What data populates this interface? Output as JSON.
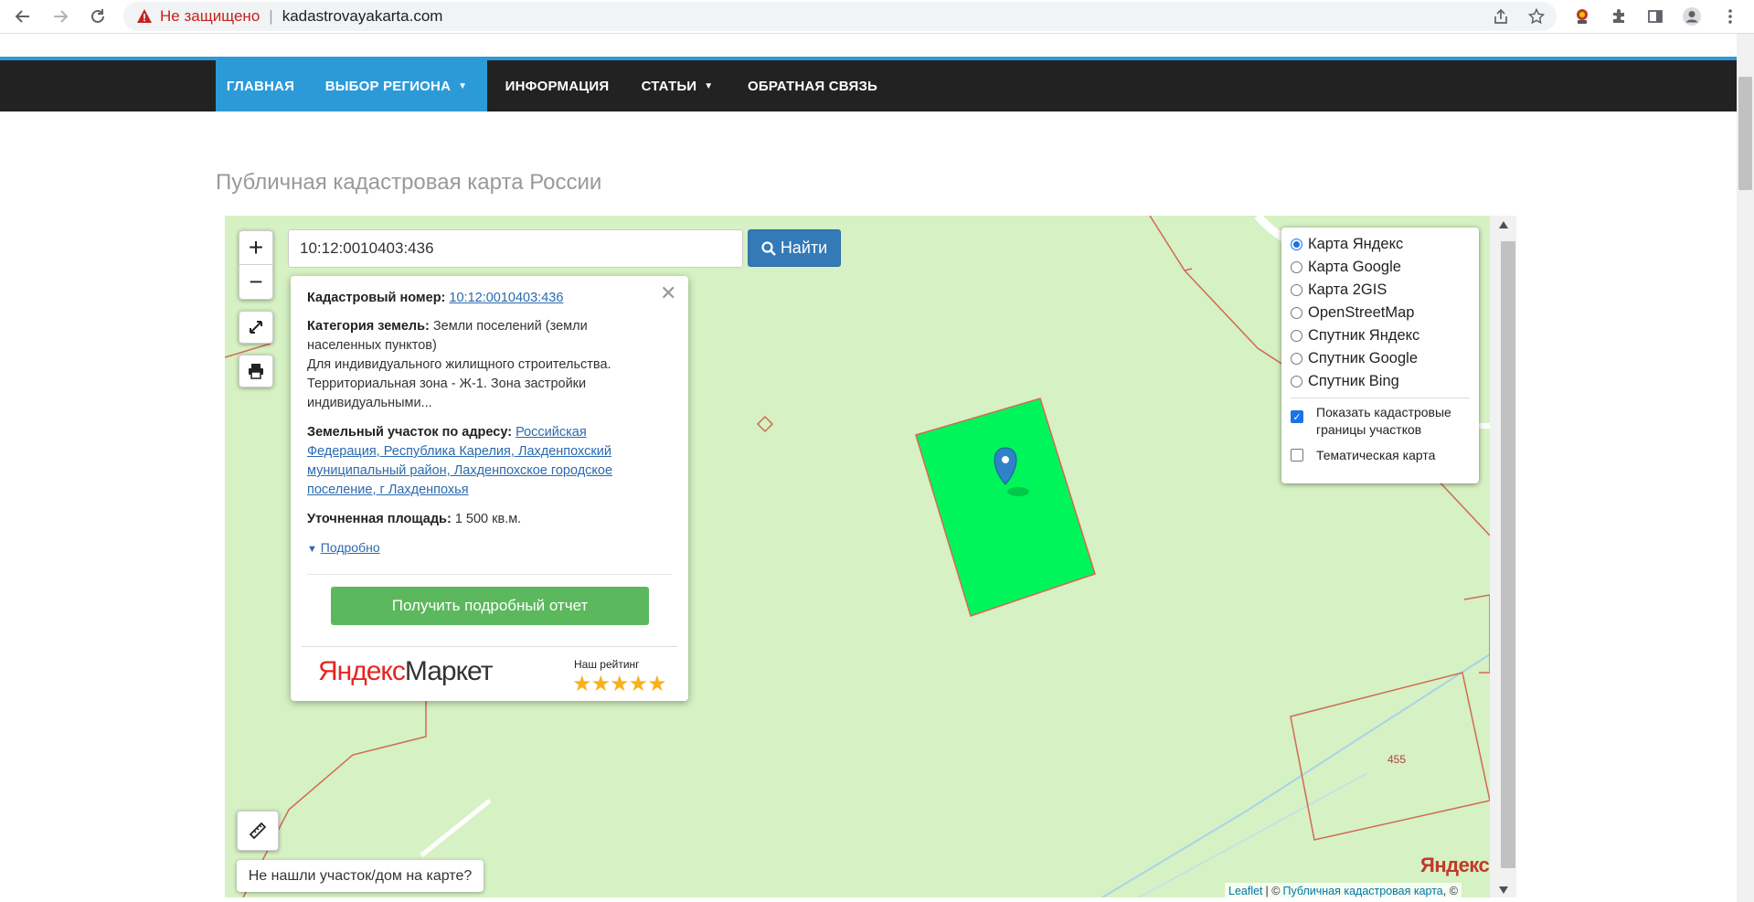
{
  "browser": {
    "security_label": "Не защищено",
    "separator": "|",
    "url": "kadastrovayakarta.com"
  },
  "nav": {
    "items": [
      {
        "label": "ГЛАВНАЯ"
      },
      {
        "label": "ВЫБОР РЕГИОНА"
      },
      {
        "label": "ИНФОРМАЦИЯ"
      },
      {
        "label": "СТАТЬИ"
      },
      {
        "label": "ОБРАТНАЯ СВЯЗЬ"
      }
    ]
  },
  "page_title": "Публичная кадастровая карта России",
  "map": {
    "zoom_in": "+",
    "zoom_out": "−",
    "search_value": "10:12:0010403:436",
    "search_button": "Найти",
    "hint": "Не нашли участок/дом на карте?",
    "parcel_label": "455",
    "yandex_logo": "Яндекс",
    "attribution": {
      "leaflet": "Leaflet",
      "divider": "| ©",
      "cadastral": "Публичная кадастровая карта",
      "tail": ", ©"
    }
  },
  "popup": {
    "cadastral_label": "Кадастровый номер:",
    "cadastral_value": "10:12:0010403:436",
    "category_label": "Категория земель:",
    "category_value": "Земли поселений (земли населенных пунктов)",
    "usage_text": "Для индивидуального жилищного строительства. Территориальная зона - Ж-1. Зона застройки индивидуальными...",
    "address_label": "Земельный участок по адресу:",
    "address_value": "Российская Федерация, Республика Карелия, Лахденпохский муниципальный район, Лахденпохское городское поселение, г Лахденпохья",
    "area_label": "Уточненная площадь:",
    "area_value": "1 500 кв.м.",
    "details_link": "Подробно",
    "report_button": "Получить подробный отчет",
    "market_logo_ya": "Яндекс",
    "market_logo_market": "Маркет",
    "rating_label": "Наш рейтинг",
    "rating_stars": "★★★★★"
  },
  "layers": {
    "options": [
      {
        "label": "Карта Яндекс",
        "selected": true
      },
      {
        "label": "Карта Google",
        "selected": false
      },
      {
        "label": "Карта 2GIS",
        "selected": false
      },
      {
        "label": "OpenStreetMap",
        "selected": false
      },
      {
        "label": "Спутник Яндекс",
        "selected": false
      },
      {
        "label": "Спутник Google",
        "selected": false
      },
      {
        "label": "Спутник Bing",
        "selected": false
      }
    ],
    "show_borders_label": "Показать кадастровые границы участков",
    "show_borders_checked": true,
    "thematic_label": "Тематическая карта",
    "thematic_checked": false
  },
  "colors": {
    "accent": "#2d9ad8",
    "nav_bg": "#222222",
    "map_bg": "#d6f1c3",
    "parcel_fill": "#00f55a",
    "parcel_border": "#d06a55",
    "report_button": "#5cb85c",
    "search_button": "#337ab7"
  }
}
